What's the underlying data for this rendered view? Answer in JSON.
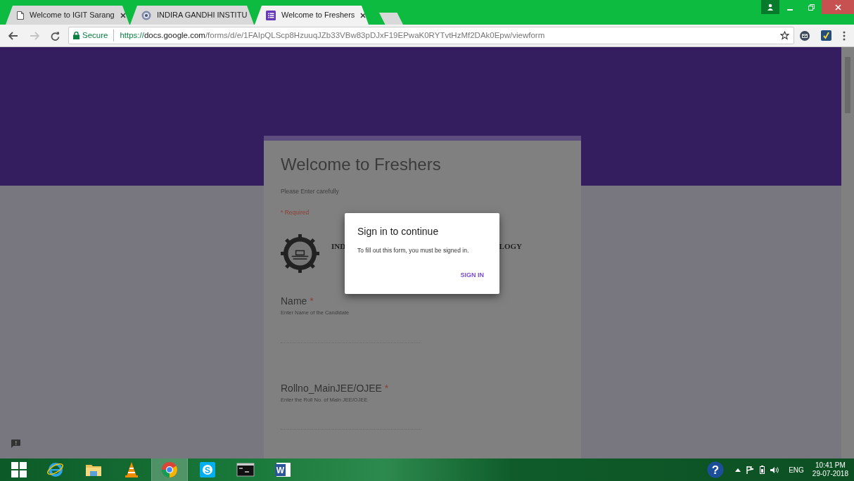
{
  "browser": {
    "tabs": [
      {
        "kind": "page",
        "title": "Welcome to IGIT Sarang",
        "selected": false
      },
      {
        "kind": "site",
        "title": "INDIRA GANDHI INSTITU",
        "selected": false
      },
      {
        "kind": "form",
        "title": "Welcome to Freshers",
        "selected": true
      }
    ],
    "forward_disabled": true,
    "address": {
      "security": "Secure",
      "url_scheme": "https://",
      "url_host": "docs.google.com",
      "url_path": "/forms/d/e/1FAIpQLScp8HzuuqJZb33VBw83pDJxF19EPwaK0RYTvtHzMf2DAk0Epw/viewform"
    }
  },
  "form": {
    "title": "Welcome to Freshers",
    "description": "Please Enter carefully",
    "required_note": "* Required",
    "logo_text_left": "IND",
    "logo_text_right": "LOGY",
    "questions": [
      {
        "label": "Name",
        "required_mark": "*",
        "hint": "Enter Name of the Candidate"
      },
      {
        "label": "Rollno_MainJEE/OJEE",
        "required_mark": "*",
        "hint": "Enter the Roll No. of Main JEE/OJEE"
      }
    ]
  },
  "dialog": {
    "title": "Sign in to continue",
    "message": "To fill out this form, you must be signed in.",
    "button": "SIGN IN"
  },
  "taskbar": {
    "apps": [
      {
        "kind": "ie",
        "active": false
      },
      {
        "kind": "explorer",
        "active": false
      },
      {
        "kind": "vlc",
        "active": false
      },
      {
        "kind": "chrome",
        "active": true
      },
      {
        "kind": "skype",
        "active": false,
        "glyph": "S"
      },
      {
        "kind": "cmd",
        "active": false
      },
      {
        "kind": "word",
        "active": false,
        "glyph": "W"
      }
    ],
    "help_glyph": "?",
    "language": "ENG",
    "time": "10:41 PM",
    "date": "29-07-2018"
  }
}
